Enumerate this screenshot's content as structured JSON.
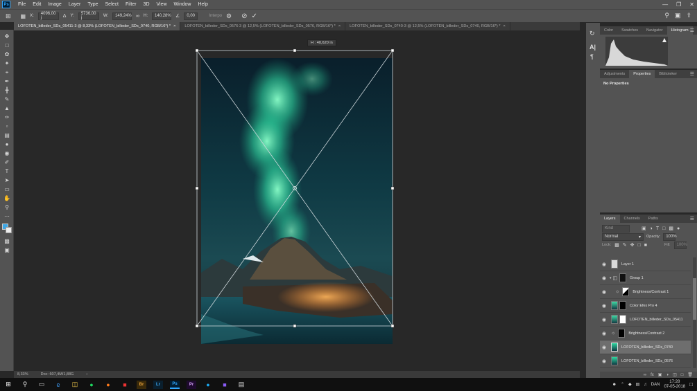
{
  "menu": {
    "items": [
      "File",
      "Edit",
      "Image",
      "Layer",
      "Type",
      "Select",
      "Filter",
      "3D",
      "View",
      "Window",
      "Help"
    ],
    "ps_logo": "Ps"
  },
  "options": {
    "x_label": "X:",
    "x_value": "4096,00 j",
    "y_label": "Y:",
    "y_value": "5736,00 j",
    "w_label": "W:",
    "w_value": "149,24%",
    "h_label": "H:",
    "h_value": "140,28%",
    "angle_value": "0,00",
    "interp_label": "Interpo"
  },
  "tabs": [
    {
      "label": "LOFOTEN_billeder_SDs_05411-3 @ 8,33% (LOFOTEN_billeder_SDs_0740, RGB/16*) *",
      "active": true
    },
    {
      "label": "LOFOTEN_billeder_SDs_0576-3 @ 12,5% (LOFOTEN_billeder_SDs_0576, RGB/16*) *",
      "active": false
    },
    {
      "label": "LOFOTEN_billeder_SDs_0740-3 @ 12,5% (LOFOTEN_billeder_SDs_0740, RGB/16*) *",
      "active": false
    }
  ],
  "transform_tooltip": "H : 40,620 in",
  "status": {
    "zoom": "8,33%",
    "doc": "Doc: 607,4M/1,88G"
  },
  "top_panel": {
    "tabs": [
      "Color",
      "Swatches",
      "Navigator",
      "Histogram"
    ]
  },
  "mid_panel": {
    "tabs": [
      "Adjustments",
      "Properties",
      "Biblioteker"
    ],
    "content": "No Properties"
  },
  "layers_panel": {
    "tabs": [
      "Layers",
      "Channels",
      "Paths"
    ],
    "search_placeholder": "Kind",
    "blend_mode": "Normal",
    "opacity_label": "Opacity:",
    "opacity_value": "100%",
    "lock_label": "Lock:",
    "fill_label": "Fill:",
    "fill_value": "100%",
    "layers": [
      {
        "name": "Layer 1",
        "selected": false
      },
      {
        "name": "Group 1",
        "selected": false
      },
      {
        "name": "Brightness/Contrast 1",
        "selected": false
      },
      {
        "name": "Color Efex Pro 4",
        "selected": false
      },
      {
        "name": "LOFOTEN_billeder_SDs_05411",
        "selected": false
      },
      {
        "name": "Brightness/Contrast 2",
        "selected": false
      },
      {
        "name": "LOFOTEN_billeder_SDs_0740",
        "selected": true
      },
      {
        "name": "LOFOTEN_billeder_SDs_0576",
        "selected": false
      }
    ]
  },
  "taskbar": {
    "time": "17:28",
    "date": "07-05-2018",
    "lang": "DAN"
  },
  "colors": {
    "accent": "#31a8ff",
    "aurora": "#3fd9a4",
    "sky": "#0d2a38"
  }
}
